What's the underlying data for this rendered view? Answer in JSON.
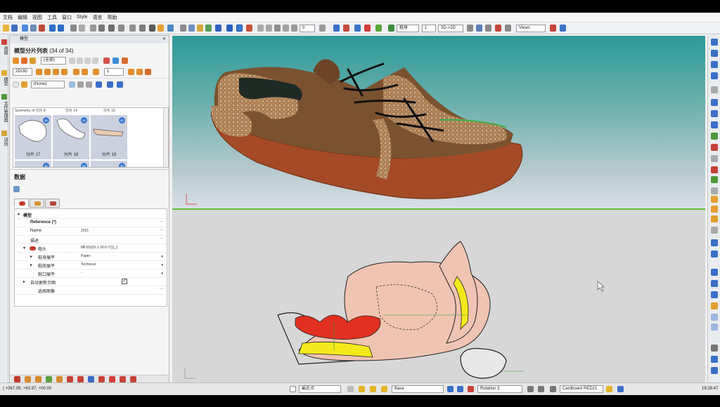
{
  "menu": [
    "文档",
    "编辑",
    "视图",
    "工具",
    "窗口",
    "Style",
    "语言",
    "帮助"
  ],
  "toolbar": {
    "num_empty": "0",
    "piece_select": "鞋身",
    "size_value": "1",
    "mode_select": "3D->2D",
    "views_select": "Views"
  },
  "left_strip": {
    "labels": [
      "视图",
      "模型",
      "文件管理器",
      "项目"
    ]
  },
  "panel": {
    "dock_title": "模型",
    "pieces_title": "模型分片列表",
    "pieces_count": "(34 of 34)",
    "filter_select": "(全部)",
    "dim_select": "2D/3D",
    "spin_value": "1",
    "preset_select": "(None)",
    "thumbs_header": [
      "Symmetry of 分片 8",
      "分片 14",
      "分片 15"
    ],
    "thumbs": [
      {
        "label": "分片 17",
        "badge": "3D"
      },
      {
        "label": "分片 18",
        "badge": "3D"
      },
      {
        "label": "分片 19",
        "badge": "3D"
      }
    ],
    "data_title": "数据",
    "props": {
      "section": "模型",
      "reference_label": "Reference (*)",
      "name_label": "Name",
      "name_value": "2021",
      "desc_label": "描述",
      "last_label": "楦头",
      "last_value": "MF20225-1 20-5-7(1)_1",
      "upper_label": "鞋身展平",
      "upper_value": "Paper",
      "sole_label": "鞋底展平",
      "sole_value": "Technical",
      "opening_label": "鞋口展平",
      "opening_value": "-",
      "autoupdate_label": "自动更新示图",
      "autoupdate_checked": true,
      "image_label": "选择图像"
    }
  },
  "status": {
    "coords": "( +367.09, +63.97, +00.00",
    "snap_select": "最近点",
    "layer_select": "Base",
    "rotation_select": "Rotation 3",
    "material_select": "Cardboard RED21",
    "clock": "19:28:47"
  },
  "colors": {
    "accent_green": "#5cc032",
    "thumb_bg": "#ccd1e0",
    "viewport_top": "#2c9a98",
    "pattern_fill": "#f0c4b2",
    "pattern_yellow": "#f3ea1c",
    "pattern_red": "#e23020"
  }
}
